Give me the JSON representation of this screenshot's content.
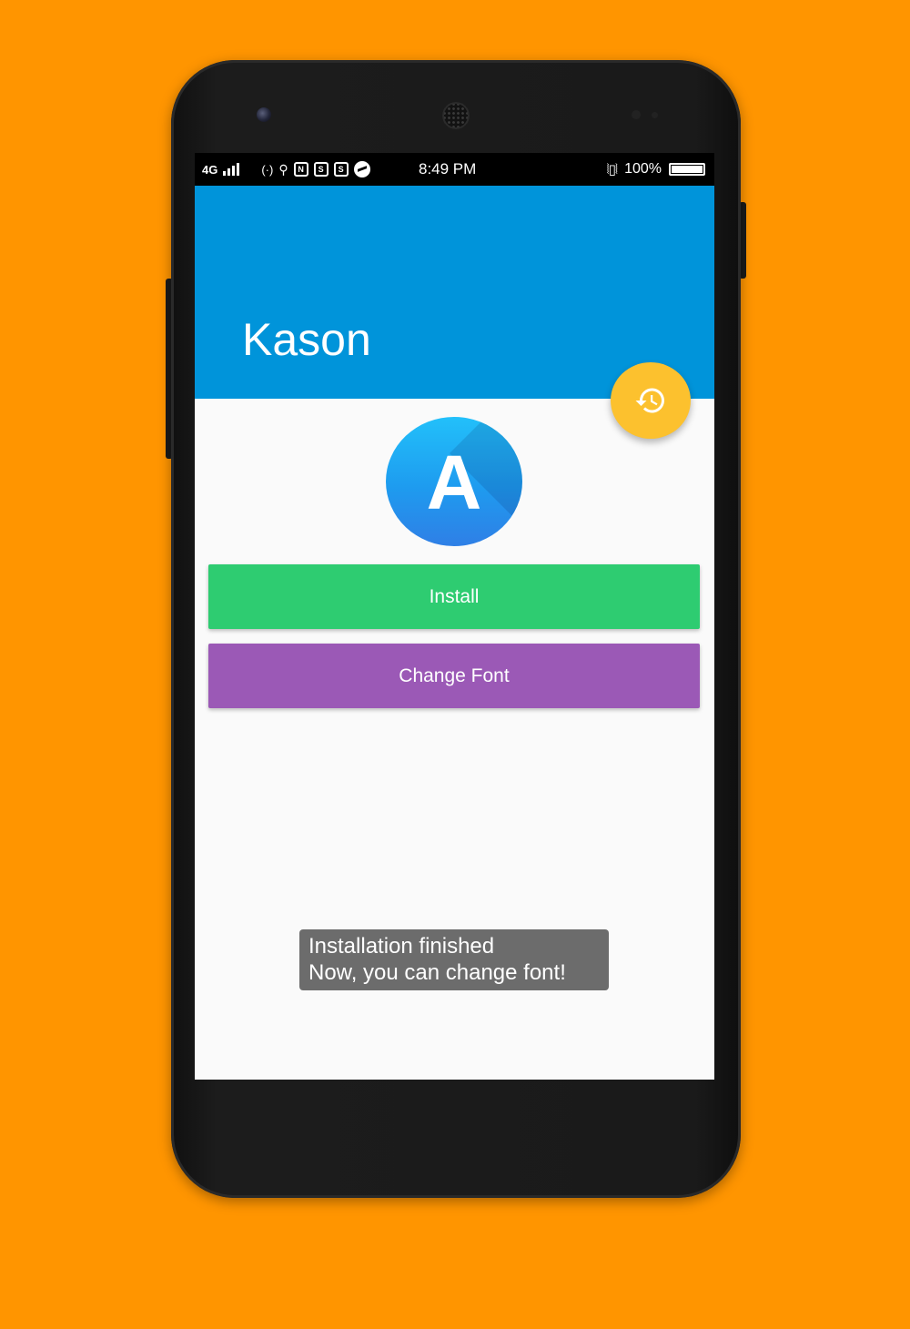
{
  "status_bar": {
    "network": "4G",
    "time": "8:49 PM",
    "battery_percent": "100%",
    "icons": [
      "signal-bars-icon",
      "hotspot-icon",
      "usb-icon",
      "notification-icon",
      "app-s-icon",
      "app-s2-icon",
      "messenger-icon",
      "vibrate-icon",
      "battery-icon"
    ]
  },
  "app_bar": {
    "title": "Kason",
    "background_color": "#0094DA"
  },
  "fab": {
    "icon": "history-icon",
    "color": "#FCC12E"
  },
  "logo": {
    "letter": "A",
    "icon": "app-logo-icon"
  },
  "buttons": {
    "install_label": "Install",
    "install_color": "#2ECC71",
    "change_font_label": "Change Font",
    "change_font_color": "#9B59B6"
  },
  "toast": {
    "line1": "Installation finished",
    "line2": "Now, you can change font!"
  },
  "background_color": "#FF9500"
}
